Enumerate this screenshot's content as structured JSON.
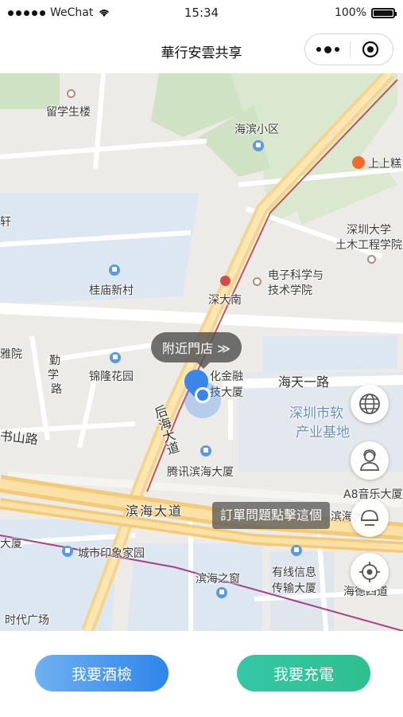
{
  "status_bar": {
    "carrier": "WeChat",
    "time": "15:34",
    "battery": "100%"
  },
  "nav": {
    "title": "華行安雲共享"
  },
  "map": {
    "labels": {
      "liuxue": "留学生楼",
      "haibin_xiaoqu": "海滨小区",
      "shangshang": "上上糕",
      "xuan": "轩",
      "szu_civil_1": "深圳大学",
      "szu_civil_2": "土木工程学院",
      "guimiao": "桂庙新村",
      "dianzi_1": "电子科学与",
      "dianzi_2": "技术学院",
      "shendanan": "深大南",
      "yayuan": "雅院",
      "xin": "勤",
      "xin2": "学",
      "xin3": "路",
      "jinlong": "锦隆花园",
      "finance_1": "化金融",
      "finance_2": "技大厦",
      "haitian": "海天一路",
      "software_1": "深圳市软",
      "software_2": "产业基地",
      "houhai": "后海大道",
      "shulu": "书山路",
      "tencent": "腾讯滨海大厦",
      "a8": "A8音乐大厦",
      "binhai_road": "滨海大道",
      "binhai_road_2": "滨海大",
      "dasha": "大厦",
      "yinxiang": "城市印象家园",
      "binhai_window": "滨海之窗",
      "cable_1": "有线信息",
      "cable_2": "传输大厦",
      "haide": "海德四道",
      "shidai": "时代广场"
    },
    "nearby_button": "附近門店 ≫",
    "report_tip": "訂單問題點擊這個"
  },
  "fabs": [
    {
      "icon": "globe-icon"
    },
    {
      "icon": "customer-service-icon"
    },
    {
      "icon": "scan-helmet-icon"
    },
    {
      "icon": "locate-icon"
    }
  ],
  "buttons": {
    "drink": "我要酒檢",
    "charge": "我要充電"
  },
  "colors": {
    "drink_button": "#2e86ea",
    "charge_button": "#2fbf8e",
    "pin": "#3a86e8"
  }
}
